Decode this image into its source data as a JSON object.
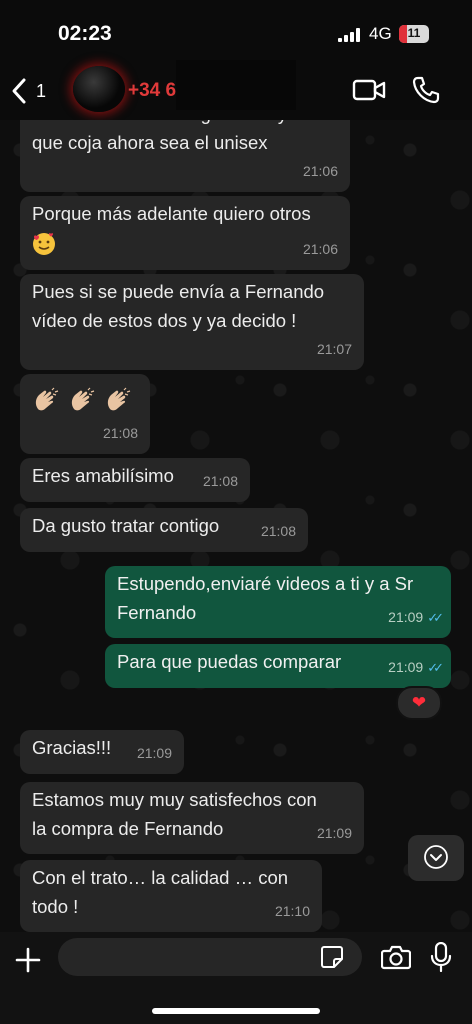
{
  "status_bar": {
    "time": "02:23",
    "network": "4G",
    "battery": "11"
  },
  "header": {
    "back_count": "1",
    "contact_name": "+34 6"
  },
  "messages": [
    {
      "lines": [
        "Puede Fernando tenga razón y el",
        "que coja ahora sea el unisex"
      ],
      "time": "21:06"
    },
    {
      "lines": [
        "Porque más adelante quiero otros"
      ],
      "time": "21:06"
    },
    {
      "lines": [
        "Pues si se puede envía a Fernando",
        "vídeo de estos dos y ya decido !"
      ],
      "time": "21:07"
    },
    {
      "time": "21:08"
    },
    {
      "text": "Eres amabilísimo",
      "time": "21:08"
    },
    {
      "text": "Da gusto tratar contigo",
      "time": "21:08"
    },
    {
      "lines": [
        "Estupendo,enviaré videos a ti y a Sr",
        "Fernando"
      ],
      "time": "21:09"
    },
    {
      "text": "Para que puedas comparar",
      "time": "21:09",
      "reaction": "❤"
    },
    {
      "text": "Gracias!!!",
      "time": "21:09"
    },
    {
      "lines": [
        "Estamos muy muy satisfechos con",
        "la compra de Fernando"
      ],
      "time": "21:09"
    },
    {
      "lines": [
        "Con el trato… la calidad … con",
        "todo !"
      ],
      "time": "21:10"
    }
  ],
  "emojis": {
    "smiling_face_with_hearts": "smiling-face-with-hearts-icon",
    "clapping_hands": "clapping-hands-icon"
  }
}
